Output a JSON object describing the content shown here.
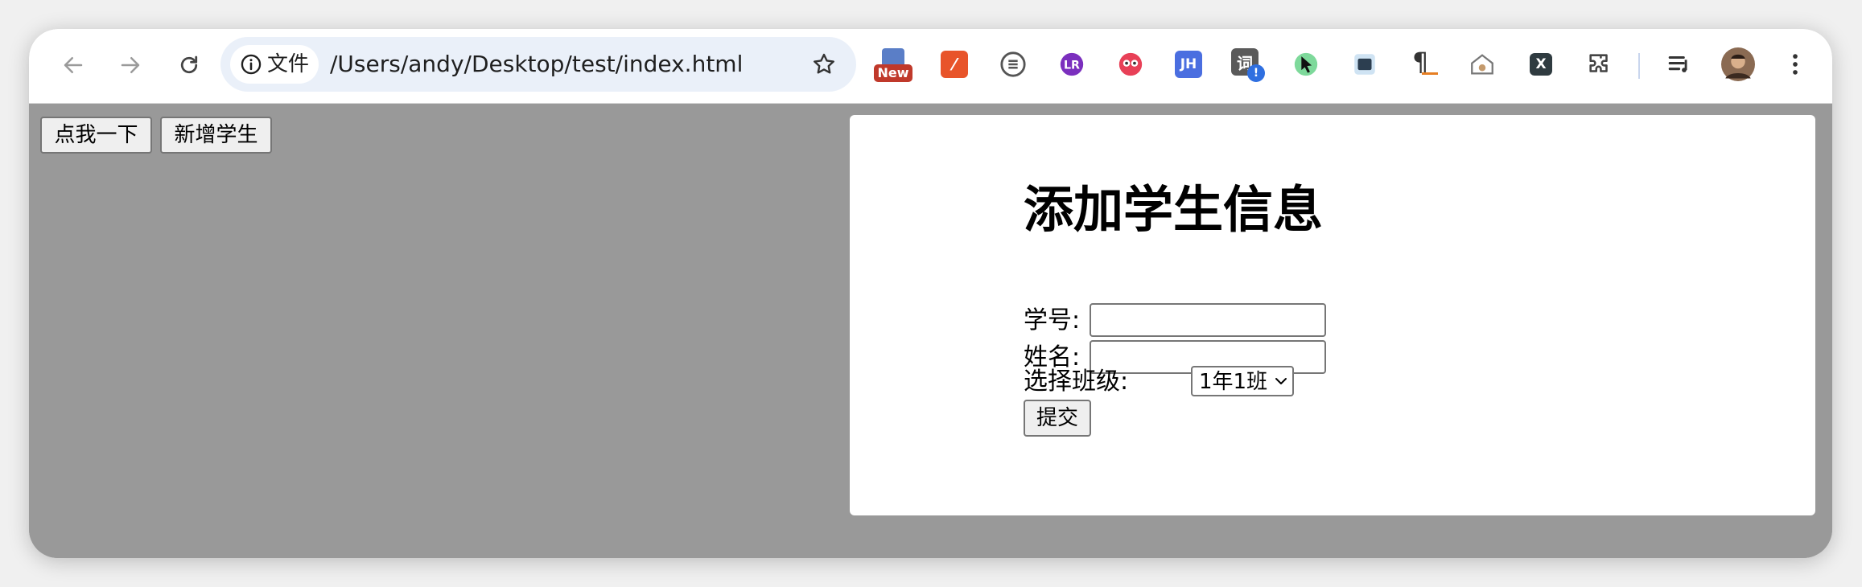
{
  "browser": {
    "site_chip_label": "文件",
    "url": "/Users/andy/Desktop/test/index.html",
    "extensions": [
      {
        "name": "new-badge-extension-icon",
        "badge": "New",
        "color": "#c0392b"
      },
      {
        "name": "sheets-extension-icon",
        "color": "#e8542a"
      },
      {
        "name": "s-logo-extension-icon",
        "color": "#444444"
      },
      {
        "name": "lr-extension-icon",
        "color": "#7b2fbe"
      },
      {
        "name": "owl-extension-icon",
        "color": "#e84057"
      },
      {
        "name": "jh-extension-icon",
        "label": "JH",
        "color": "#4a6ee0"
      },
      {
        "name": "dictionary-extension-icon",
        "label": "词",
        "color": "#5a5a5a",
        "badge": "!"
      },
      {
        "name": "cursor-extension-icon",
        "color": "#2ecc71"
      },
      {
        "name": "code-extension-icon",
        "color": "#2c3e50"
      },
      {
        "name": "pilcrow-extension-icon",
        "label": "¶",
        "color": "#333333"
      },
      {
        "name": "home-extension-icon",
        "color": "#888888"
      },
      {
        "name": "x-extension-icon",
        "label": "X",
        "color": "#2f3b40"
      },
      {
        "name": "puzzle-extensions-icon",
        "color": "#444444"
      }
    ]
  },
  "page": {
    "button_click": "点我一下",
    "button_add_student": "新增学生"
  },
  "form": {
    "title": "添加学生信息",
    "student_id_label": "学号:",
    "student_id_value": "",
    "name_label": "姓名:",
    "name_value": "",
    "class_label": "选择班级:",
    "class_selected": "1年1班",
    "submit_label": "提交"
  }
}
